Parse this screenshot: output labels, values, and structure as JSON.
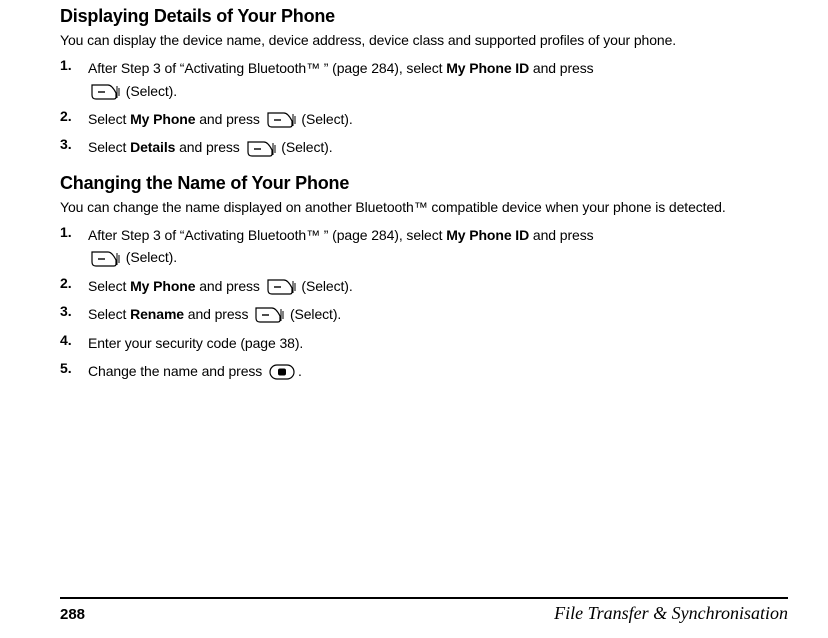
{
  "section1": {
    "heading": "Displaying Details of Your Phone",
    "intro": "You can display the device name, device address, device class and supported profiles of your phone.",
    "steps": [
      {
        "num": "1.",
        "pre": "After Step 3 of “Activating Bluetooth™ ” (page 284), select ",
        "bold": "My Phone ID",
        "mid": " and press ",
        "icon": "softkey",
        "post": " (Select)."
      },
      {
        "num": "2.",
        "pre": "Select ",
        "bold": "My Phone",
        "mid": " and press ",
        "icon": "softkey",
        "post": " (Select)."
      },
      {
        "num": "3.",
        "pre": "Select ",
        "bold": "Details",
        "mid": " and press ",
        "icon": "softkey",
        "post": " (Select)."
      }
    ]
  },
  "section2": {
    "heading": "Changing the Name of Your Phone",
    "intro": "You can change the name displayed on another Bluetooth™  compatible device when your phone is detected.",
    "steps": [
      {
        "num": "1.",
        "pre": "After Step 3 of “Activating Bluetooth™ ” (page 284), select ",
        "bold": "My Phone ID",
        "mid": " and press ",
        "icon": "softkey",
        "post": " (Select)."
      },
      {
        "num": "2.",
        "pre": "Select ",
        "bold": "My Phone",
        "mid": " and press ",
        "icon": "softkey",
        "post": " (Select)."
      },
      {
        "num": "3.",
        "pre": "Select ",
        "bold": "Rename",
        "mid": " and press ",
        "icon": "softkey",
        "post": " (Select)."
      },
      {
        "num": "4.",
        "pre": "Enter your security code (page 38).",
        "bold": "",
        "mid": "",
        "icon": "",
        "post": ""
      },
      {
        "num": "5.",
        "pre": "Change the name and press ",
        "bold": "",
        "mid": "",
        "icon": "okkey",
        "post": "."
      }
    ]
  },
  "footer": {
    "page": "288",
    "title": "File Transfer & Synchronisation"
  }
}
